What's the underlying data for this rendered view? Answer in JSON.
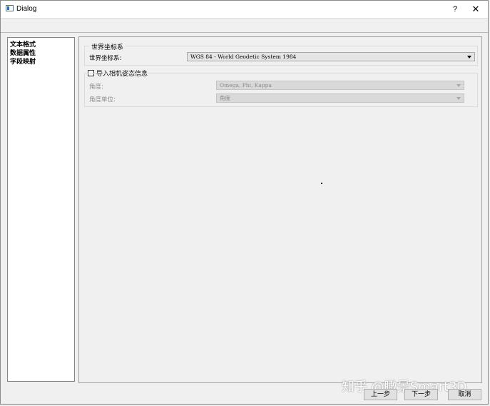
{
  "window": {
    "title": "Dialog",
    "help_label": "?",
    "close_label": "✕"
  },
  "sidebar": {
    "items": [
      {
        "label": "文本格式"
      },
      {
        "label": "数据属性"
      },
      {
        "label": "字段映射"
      }
    ]
  },
  "world_crs_group": {
    "title": "世界坐标系",
    "field_label": "世界坐标系:",
    "value": "WGS 84 - World Geodetic System 1984"
  },
  "camera_group": {
    "checkbox_label": "导入相机姿态信息",
    "checked": false,
    "angle_label": "角度:",
    "angle_value": "Omega, Phi, Kappa",
    "angle_unit_label": "角度单位:",
    "angle_unit_value": "角度"
  },
  "watermark": "知乎 @瞰景Smart3D",
  "buttons": {
    "prev": "上一步",
    "next": "下一步",
    "cancel": "取消"
  }
}
